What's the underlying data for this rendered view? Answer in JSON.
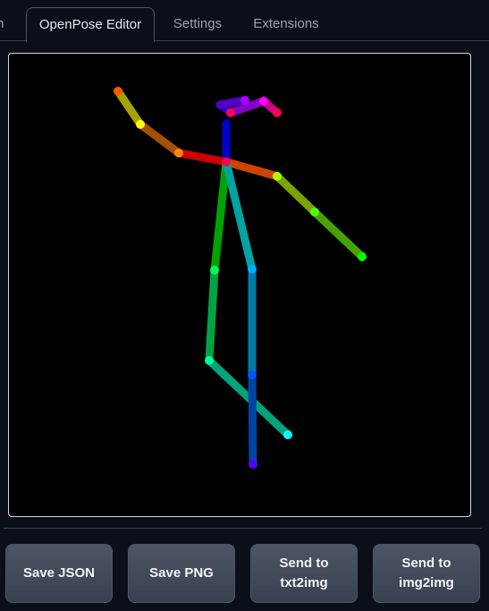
{
  "tabs": {
    "partial_label": "n",
    "active_label": "OpenPose Editor",
    "settings_label": "Settings",
    "extensions_label": "Extensions"
  },
  "canvas": {
    "background": "#000000",
    "pose": "openpose-skeleton"
  },
  "buttons": {
    "save_json": "Save JSON",
    "save_png": "Save PNG",
    "send_txt2img": "Send to\ntxt2img",
    "send_img2img": "Send to\nimg2img"
  },
  "colors": {
    "page_bg": "#0b0f19",
    "tab_active_text": "#e5e7eb",
    "tab_text": "#9ca3af",
    "button_bg": "#4b5563"
  }
}
